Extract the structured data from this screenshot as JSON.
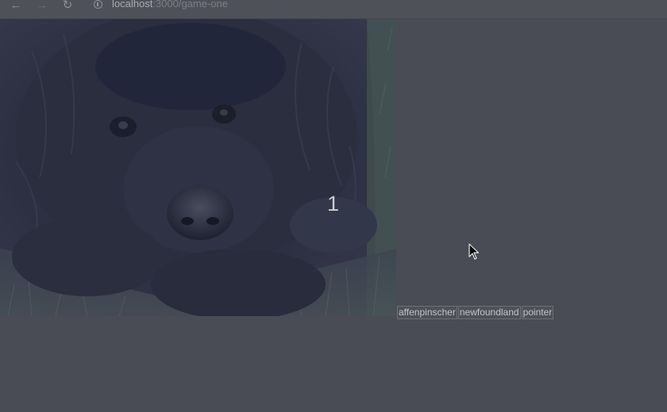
{
  "browser": {
    "url_host": "localhost",
    "url_path": ":3000/game-one",
    "icons": [
      "back-arrow-icon",
      "forward-arrow-icon",
      "reload-icon",
      "info-icon"
    ]
  },
  "game": {
    "image_subject": "newfoundland dog photo",
    "counter": "1",
    "choices": [
      "affenpinscher",
      "newfoundland",
      "pointer"
    ]
  },
  "colors": {
    "page_background": "#4a4c55",
    "toolbar": "#4f5159",
    "button_border": "#6e7078",
    "text": "#c2c3c7"
  }
}
